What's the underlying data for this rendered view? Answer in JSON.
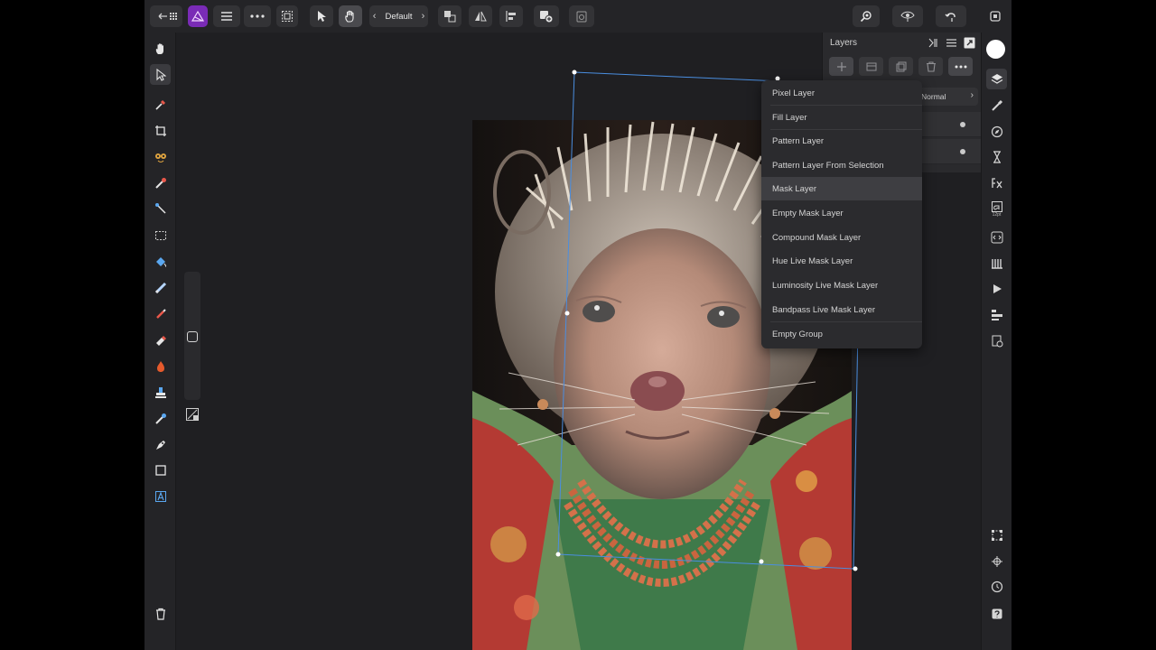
{
  "toolbar": {
    "preset": {
      "label": "Default"
    }
  },
  "layers_panel": {
    "title": "Layers",
    "blend_mode": "Normal"
  },
  "add_layer_menu": {
    "items": [
      "Pixel Layer",
      "Fill Layer",
      "Pattern Layer",
      "Pattern Layer From Selection",
      "Mask Layer",
      "Empty Mask Layer",
      "Compound Mask Layer",
      "Hue Live Mask Layer",
      "Luminosity Live Mask Layer",
      "Bandpass Live Mask Layer",
      "Empty Group"
    ],
    "selected": "Mask Layer"
  },
  "right_studio": {
    "character_panel_label": "12pt"
  },
  "icons": {
    "app_logo": "affinity-photo-logo-icon",
    "accent": "#b43cf0"
  }
}
